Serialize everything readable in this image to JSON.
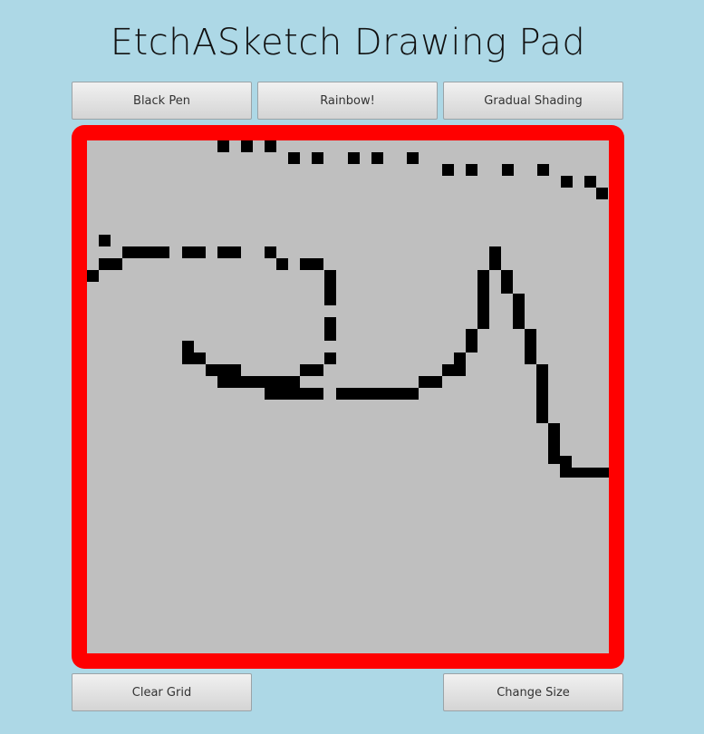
{
  "title": "EtchASketch Drawing Pad",
  "modes": {
    "black_pen": "Black Pen",
    "rainbow": "Rainbow!",
    "gradual_shading": "Gradual Shading"
  },
  "actions": {
    "clear_grid": "Clear Grid",
    "change_size": "Change Size"
  },
  "colors": {
    "background": "#add8e6",
    "frame": "#ff0000",
    "grid_background": "#bfbfbf",
    "ink": "#000000"
  }
}
